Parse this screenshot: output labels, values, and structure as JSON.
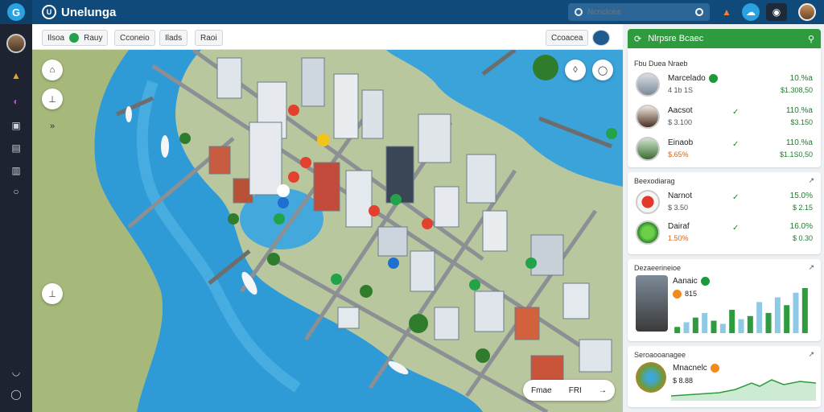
{
  "app": {
    "title": "Unelunga"
  },
  "search": {
    "placeholder": "Ncnclcea"
  },
  "map_header": {
    "chips": [
      "Ilsoa",
      "Rauy",
      "Cconeio",
      "Ilads",
      "Raoi"
    ],
    "right_button": "Ccoacea"
  },
  "right_panel": {
    "header_title": "Nlrpsre Bcaec",
    "leaderboard": {
      "title": "Fbu Duea Nraeb",
      "rows": [
        {
          "name": "Marcelado",
          "sub": "4 1b 1S",
          "pct": "10.%a",
          "value": "$1.308,50"
        },
        {
          "name": "Aacsot",
          "sub": "$ 3.100",
          "pct": "110.%a",
          "value": "$3.150"
        },
        {
          "name": "Einaob",
          "sub": "$.65%",
          "pct": "110.%a",
          "value": "$1.1S0,50"
        }
      ]
    },
    "section2": {
      "title": "Beexodiarag",
      "rows": [
        {
          "name": "Narnot",
          "sub": "$ 3.50",
          "pct": "15.0%",
          "value": "$ 2.15"
        },
        {
          "name": "Dairaf",
          "sub": "1.50%",
          "pct": "16.0%",
          "value": "$ 0.30"
        }
      ]
    },
    "section3": {
      "title": "Dezaeerineioe",
      "name": "Aanaic",
      "sub": "815"
    },
    "section4": {
      "title": "Seroaooanagee",
      "name": "Mnacnelc",
      "sub": "$ 8.88"
    }
  },
  "map_footer": {
    "left": "Fmae",
    "right": "FRI"
  },
  "chart_data": {
    "type": "bar",
    "title": "",
    "series": [
      {
        "values": [
          8,
          14,
          20,
          26,
          16,
          12,
          30,
          18,
          22,
          40,
          26,
          46,
          36,
          52,
          58
        ]
      }
    ]
  },
  "colors": {
    "topbar": "#0f4a7a",
    "sidebar": "#1d2330",
    "accent_green": "#2e9b3e",
    "water": "#2e9ad6"
  }
}
